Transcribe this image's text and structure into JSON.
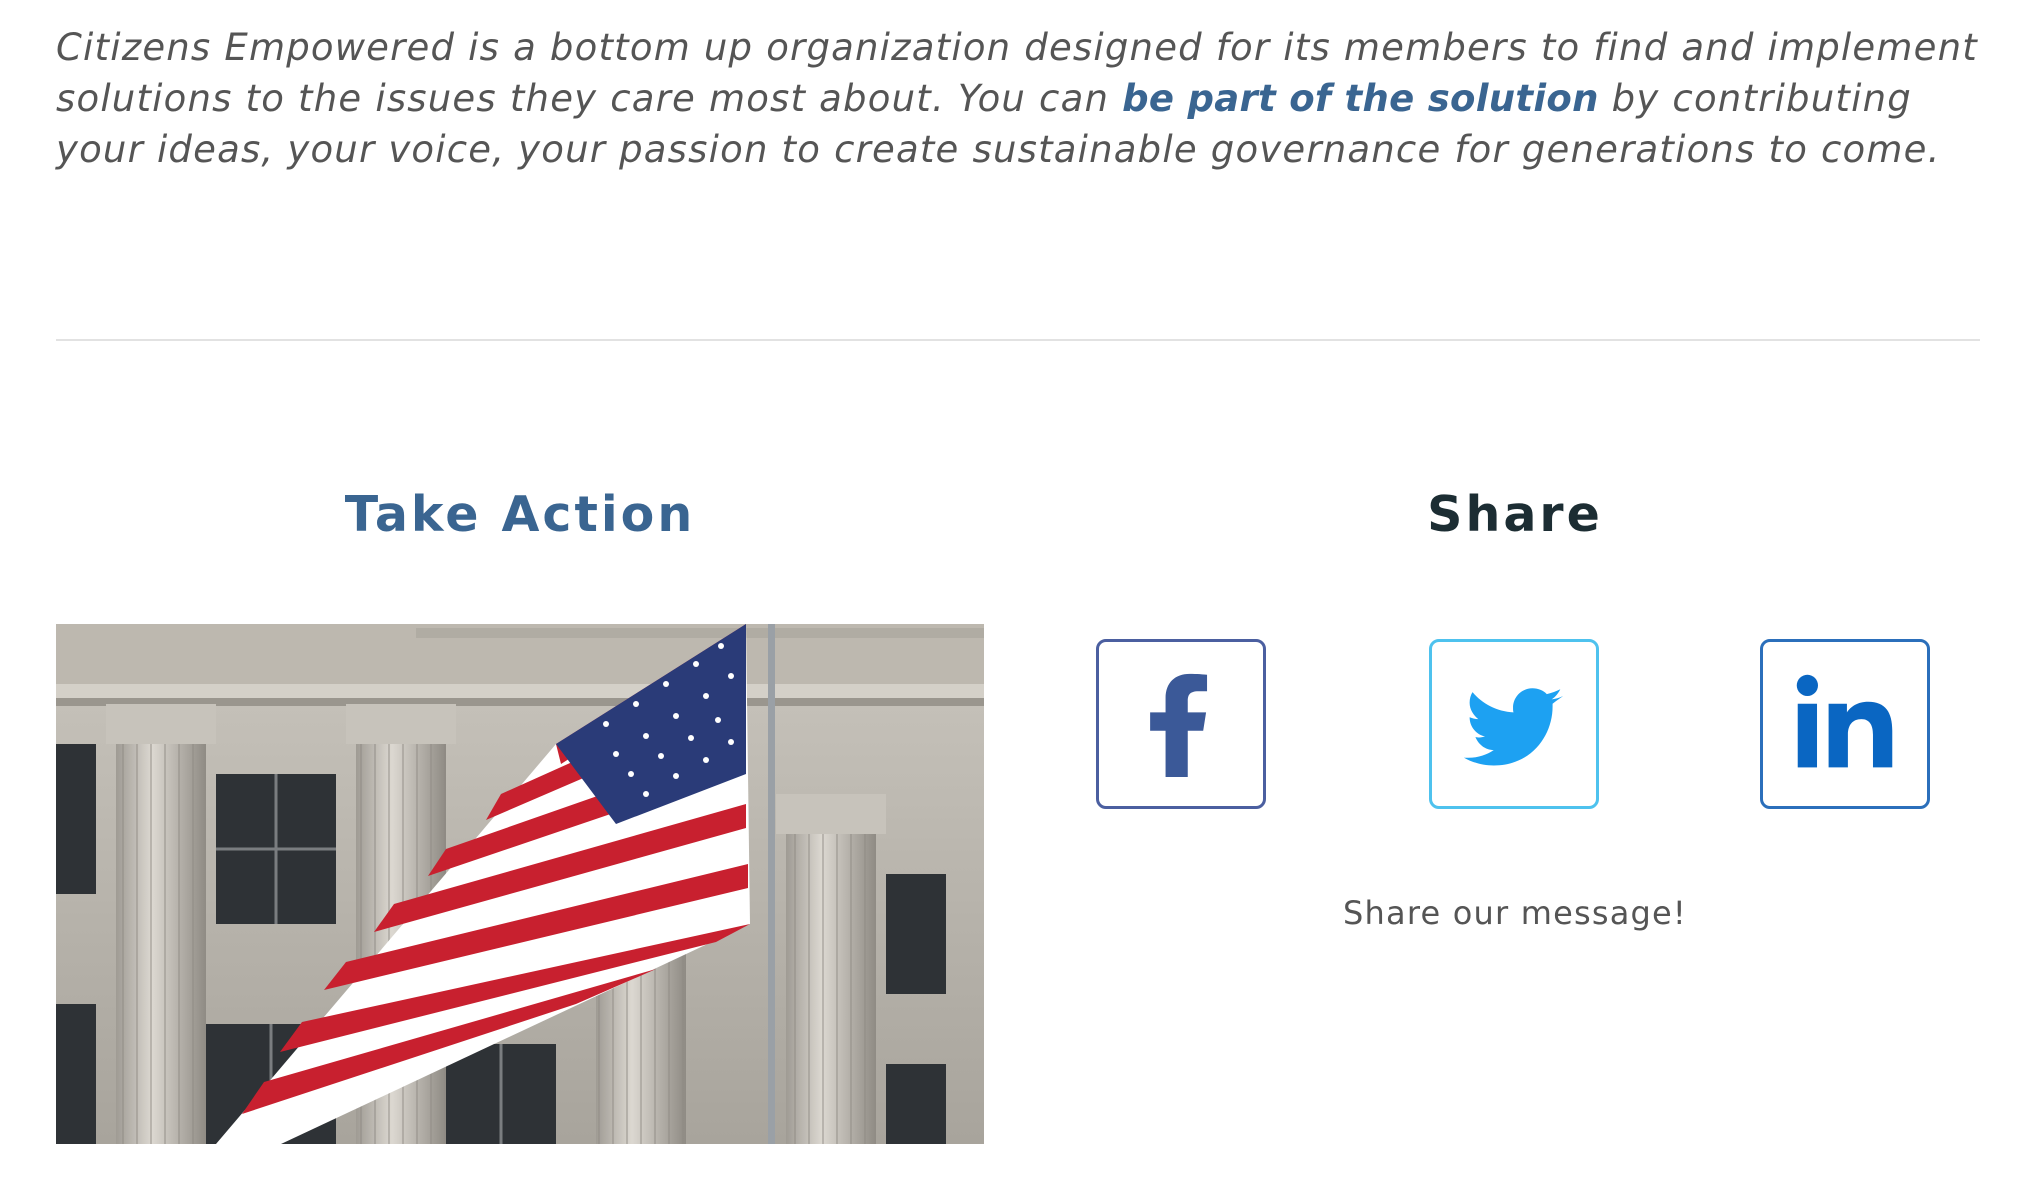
{
  "intro": {
    "text_before": "Citizens Empowered is a bottom up organization designed for its members to find and implement solutions to the issues they care most about.  You can ",
    "link_text": "be part of the solution",
    "text_after": " by contributing your ideas, your voice, your passion to create sustainable governance for generations to come."
  },
  "take_action": {
    "heading": "Take Action"
  },
  "share": {
    "heading": "Share",
    "caption": "Share our message!",
    "buttons": [
      {
        "icon": "facebook-icon",
        "color": "#3b5998"
      },
      {
        "icon": "twitter-icon",
        "color": "#1da1f2"
      },
      {
        "icon": "linkedin-icon",
        "color": "#0a66c2"
      }
    ]
  },
  "colors": {
    "link": "#3a6591",
    "heading_action": "#3a6591",
    "heading_share": "#1c2d33",
    "body_text": "#555555",
    "divider": "#e2e2e2"
  }
}
